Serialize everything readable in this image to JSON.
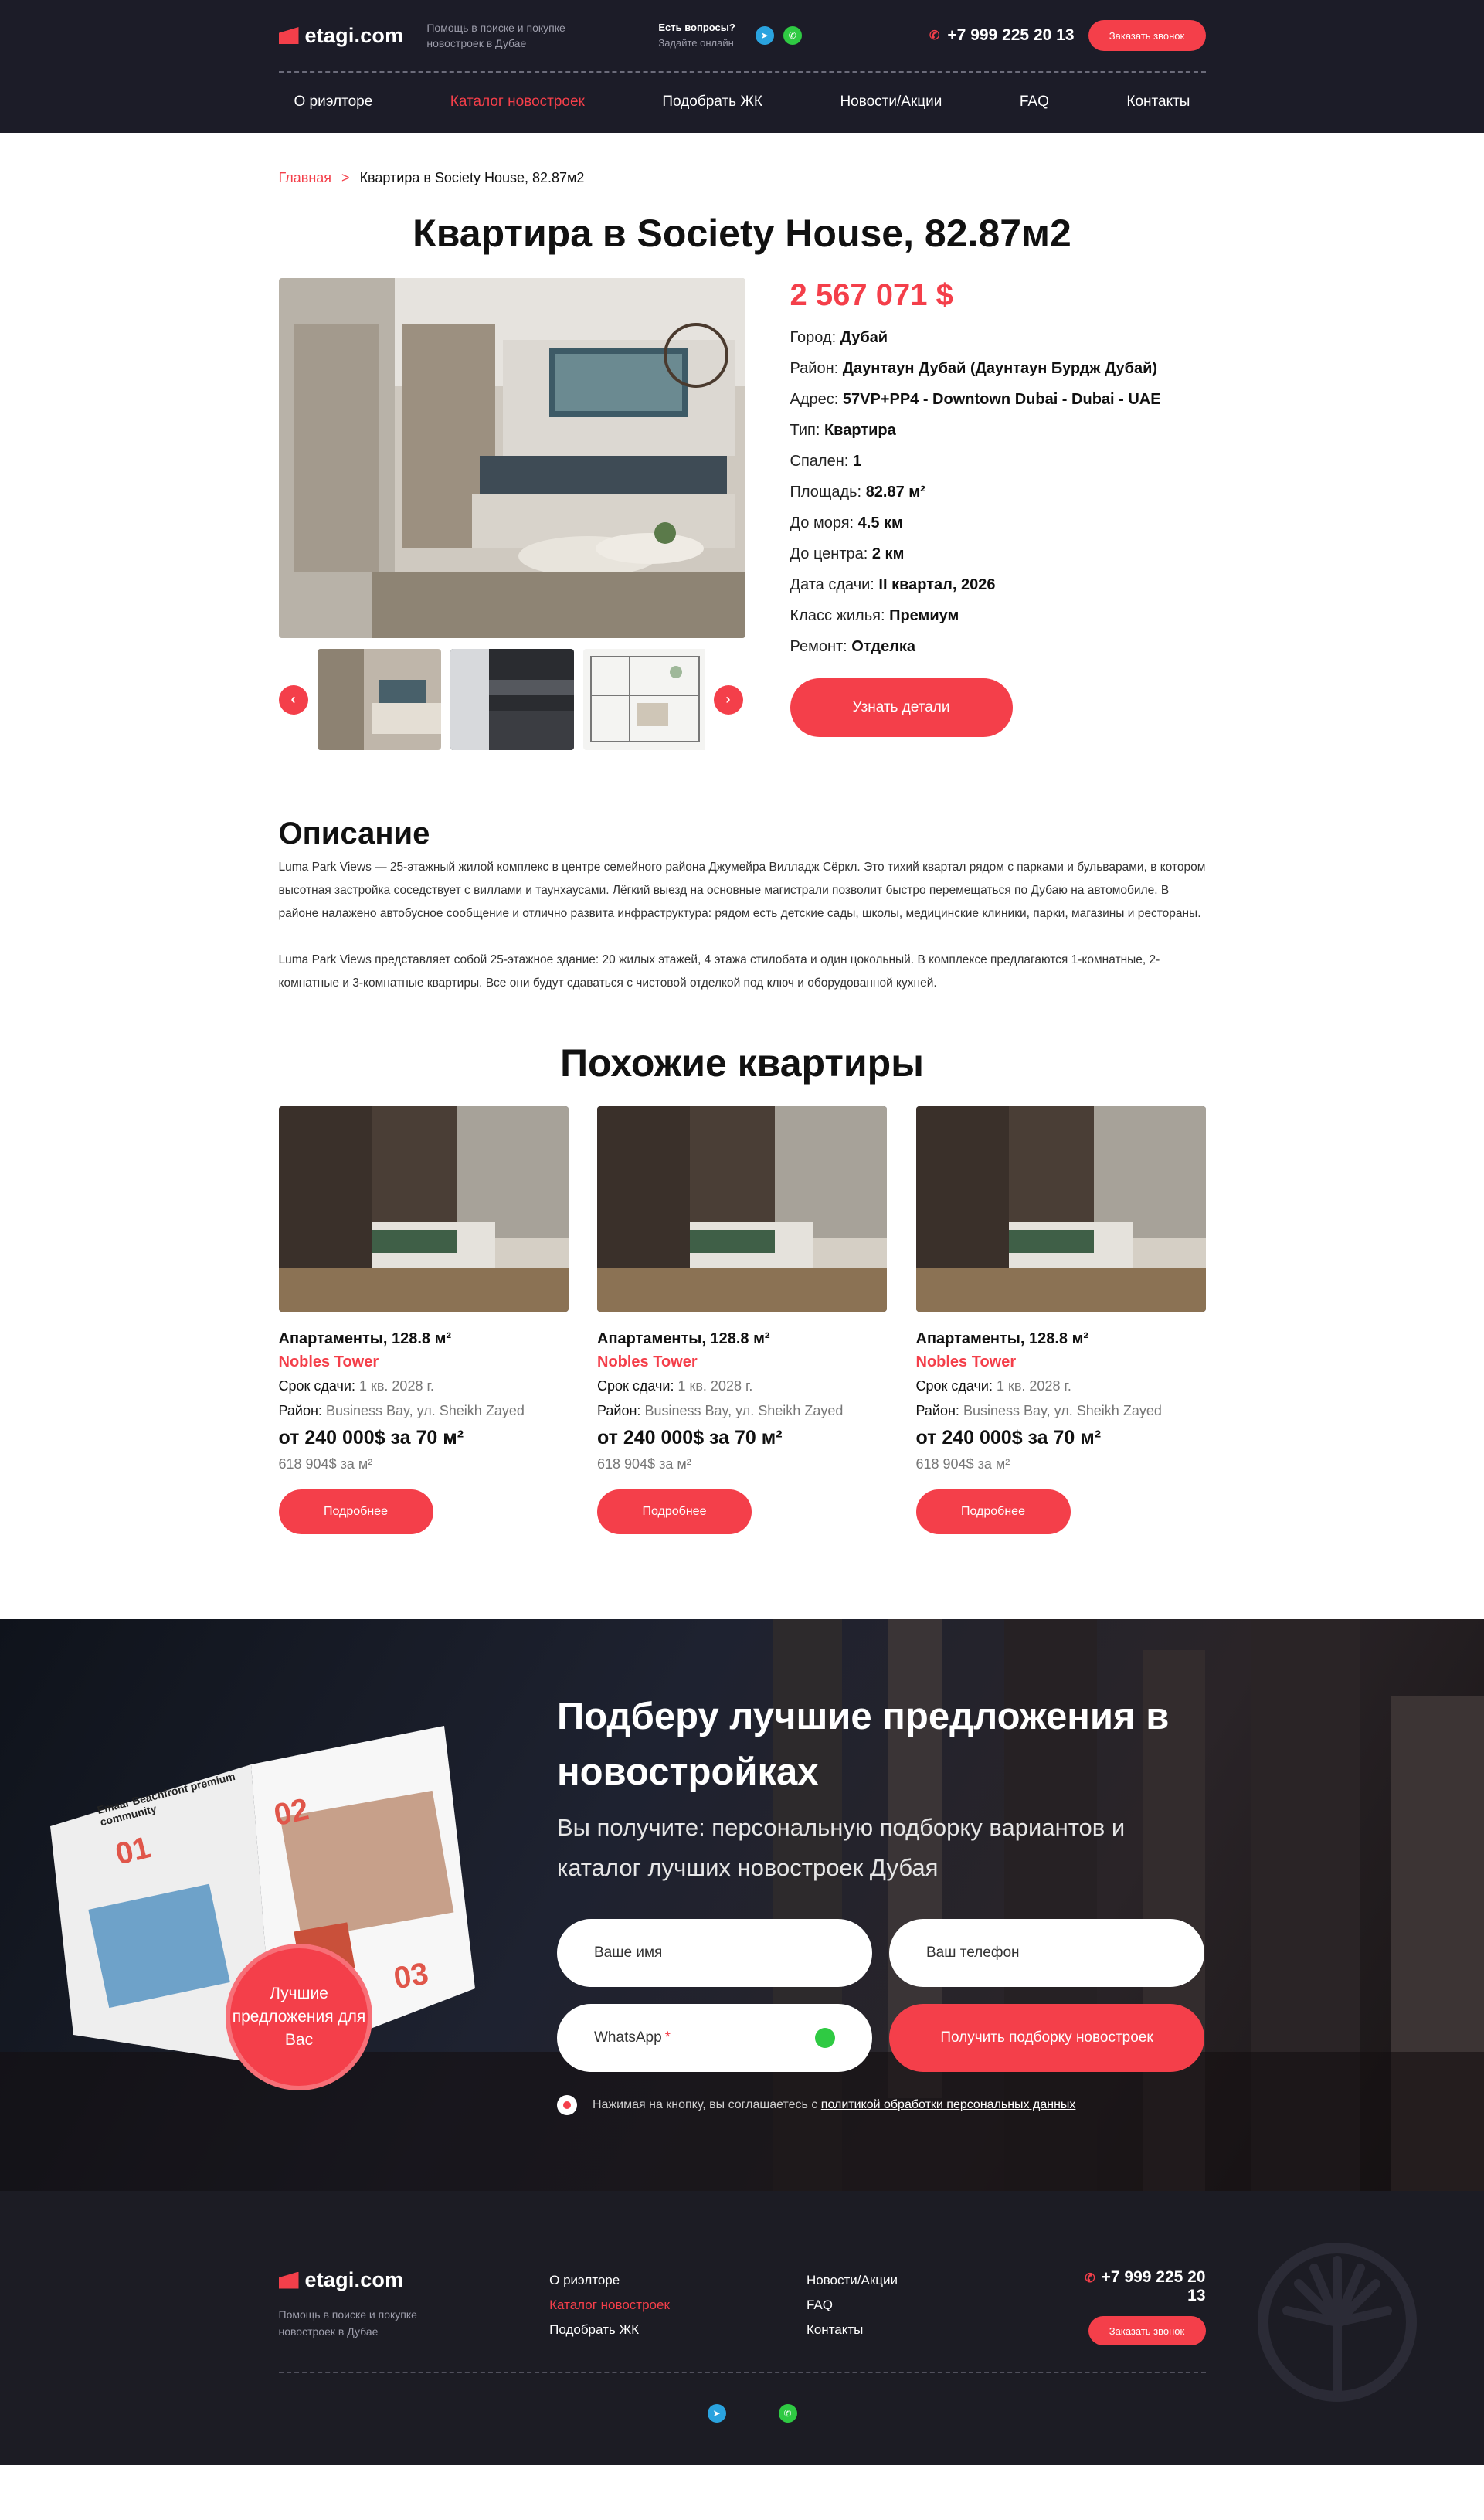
{
  "header": {
    "logo": "etagi.com",
    "tagline": "Помощь в поиске и покупке новостроек в Дубае",
    "ask_title": "Есть вопросы?",
    "ask_sub": "Задайте онлайн",
    "phone": "+7 999 225 20 13",
    "call_button": "Заказать звонок"
  },
  "nav": [
    {
      "label": "О риэлторе"
    },
    {
      "label": "Каталог новостроек",
      "active": true
    },
    {
      "label": "Подобрать  ЖК"
    },
    {
      "label": "Новости/Акции"
    },
    {
      "label": "FAQ"
    },
    {
      "label": "Контакты"
    }
  ],
  "breadcrumb": {
    "home": "Главная",
    "sep": ">",
    "current": "Квартира в Society House, 82.87м2"
  },
  "title": "Квартира в Society House, 82.87м2",
  "price": "2 567 071 $",
  "specs": [
    {
      "label": "Город:",
      "value": "Дубай"
    },
    {
      "label": "Район:",
      "value": "Даунтаун Дубай (Даунтаун Бурдж Дубай)"
    },
    {
      "label": "Адрес:",
      "value": "57VP+PP4 - Downtown Dubai - Dubai - UAE"
    },
    {
      "label": "Тип:",
      "value": "Квартира"
    },
    {
      "label": "Спален:",
      "value": "1"
    },
    {
      "label": "Площадь:",
      "value": "82.87 м²"
    },
    {
      "label": "До моря:",
      "value": "4.5 км"
    },
    {
      "label": "До центра:",
      "value": "2 км"
    },
    {
      "label": "Дата сдачи:",
      "value": "II квартал, 2026"
    },
    {
      "label": "Класс жилья:",
      "value": "Премиум"
    },
    {
      "label": "Ремонт:",
      "value": "Отделка"
    }
  ],
  "details_button": "Узнать детали",
  "description": {
    "heading": "Описание",
    "p1": "Luma Park Views — 25-этажный жилой комплекс в центре семейного района Джумейра Вилладж Сёркл. Это тихий квартал рядом с парками и бульварами, в котором высотная застройка соседствует с виллами и таунхаусами. Лёгкий выезд на основные магистрали позволит быстро перемещаться по Дубаю на автомобиле. В районе налажено автобусное сообщение и отлично развита инфраструктура: рядом есть детские сады, школы, медицинские клиники, парки, магазины и рестораны.",
    "p2": "Luma Park Views представляет собой 25-этажное здание: 20 жилых этажей, 4 этажа стилобата и один цокольный. В комплексе предлагаются 1-комнатные, 2-комнатные и 3-комнатные квартиры. Все они будут сдаваться с чистовой отделкой под ключ и оборудованной кухней."
  },
  "similar": {
    "heading": "Похожие квартиры",
    "cards": [
      {
        "title": "Апартаменты, 128.8 м²",
        "name": "Nobles Tower",
        "term_label": "Срок сдачи:",
        "term": "1 кв. 2028 г.",
        "district_label": "Район:",
        "district": "Business Bay, ул. Sheikh Zayed",
        "price": "от 240 000$ за 70 м²",
        "per": "618 904$ за м²",
        "button": "Подробнее"
      },
      {
        "title": "Апартаменты, 128.8 м²",
        "name": "Nobles Tower",
        "term_label": "Срок сдачи:",
        "term": "1 кв. 2028 г.",
        "district_label": "Район:",
        "district": "Business Bay, ул. Sheikh Zayed",
        "price": "от 240 000$ за 70 м²",
        "per": "618 904$ за м²",
        "button": "Подробнее"
      },
      {
        "title": "Апартаменты, 128.8 м²",
        "name": "Nobles Tower",
        "term_label": "Срок сдачи:",
        "term": "1 кв. 2028 г.",
        "district_label": "Район:",
        "district": "Business Bay, ул. Sheikh Zayed",
        "price": "от 240 000$ за 70 м²",
        "per": "618 904$ за м²",
        "button": "Подробнее"
      }
    ]
  },
  "cta": {
    "heading": "Подберу лучшие предложения в новостройках",
    "sub": "Вы получите: персональную подборку вариантов и каталог лучших новостроек Дубая",
    "name_placeholder": "Ваше имя",
    "phone_placeholder": "Ваш телефон",
    "whatsapp_placeholder": "WhatsApp",
    "whatsapp_required": "*",
    "submit": "Получить подборку новостроек",
    "agree_text": "Нажимая на кнопку, вы соглашаетесь с",
    "agree_link": "политикой обработки персональных данных",
    "badge": "Лучшие предложения для Вас",
    "book_title": "Emaar Beachfront premium community",
    "book_n1": "01",
    "book_n2": "02",
    "book_n3": "03"
  },
  "footer": {
    "logo": "etagi.com",
    "tagline": "Помощь в поиске и покупке новостроек в Дубае",
    "col1": [
      {
        "label": "О риэлторе"
      },
      {
        "label": "Каталог новостроек",
        "active": true
      },
      {
        "label": "Подобрать  ЖК"
      }
    ],
    "col2": [
      {
        "label": "Новости/Акции"
      },
      {
        "label": "FAQ"
      },
      {
        "label": "Контакты"
      }
    ],
    "phone": "+7 999 225 20 13",
    "call_button": "Заказать звонок"
  },
  "colors": {
    "accent": "#f43f4a",
    "dark": "#1c1c28",
    "telegram": "#2aa3df",
    "whatsapp": "#2fca43"
  }
}
